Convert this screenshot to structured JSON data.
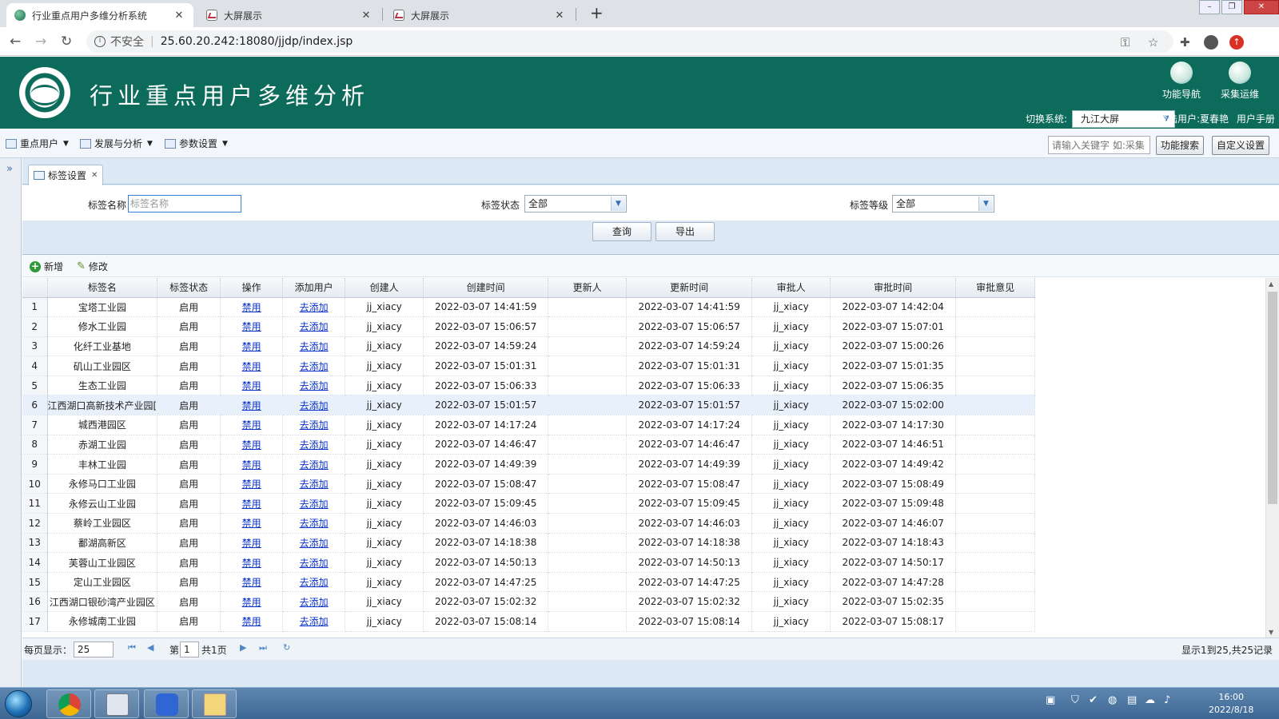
{
  "browser": {
    "tabs": [
      {
        "title": "行业重点用户多维分析系统",
        "active": true
      },
      {
        "title": "大屏展示",
        "active": false
      },
      {
        "title": "大屏展示",
        "active": false
      }
    ],
    "insecure_label": "不安全",
    "url": "25.60.20.242:18080/jjdp/index.jsp"
  },
  "header": {
    "title": "行业重点用户多维分析",
    "nav_button": "功能导航",
    "collect_button": "采集运维",
    "switch_label": "切换系统:",
    "switch_value": "九江大屏",
    "user_label": "登陆用户:夏春艳",
    "manual": "用户手册"
  },
  "menubar": {
    "items": [
      "重点用户",
      "发展与分析",
      "参数设置"
    ],
    "search_placeholder": "请输入关键字 如:采集",
    "search_button": "功能搜索",
    "custom_button": "自定义设置"
  },
  "panel": {
    "tab_label": "标签设置",
    "filters": {
      "name_label": "标签名称",
      "name_placeholder": "标签名称",
      "status_label": "标签状态",
      "status_value": "全部",
      "level_label": "标签等级",
      "level_value": "全部"
    },
    "query_button": "查询",
    "export_button": "导出",
    "add_button": "新增",
    "edit_button": "修改"
  },
  "grid": {
    "columns": [
      "标签名",
      "标签状态",
      "操作",
      "添加用户",
      "创建人",
      "创建时间",
      "更新人",
      "更新时间",
      "审批人",
      "审批时间",
      "审批意见"
    ],
    "selected_row": 6,
    "rows": [
      {
        "n": "1",
        "name": "宝塔工业园",
        "status": "启用",
        "op": "禁用",
        "add": "去添加",
        "creator": "jj_xiacy",
        "ctime": "2022-03-07 14:41:59",
        "updater": "",
        "utime": "2022-03-07 14:41:59",
        "approver": "jj_xiacy",
        "atime": "2022-03-07 14:42:04",
        "opinion": ""
      },
      {
        "n": "2",
        "name": "修水工业园",
        "status": "启用",
        "op": "禁用",
        "add": "去添加",
        "creator": "jj_xiacy",
        "ctime": "2022-03-07 15:06:57",
        "updater": "",
        "utime": "2022-03-07 15:06:57",
        "approver": "jj_xiacy",
        "atime": "2022-03-07 15:07:01",
        "opinion": ""
      },
      {
        "n": "3",
        "name": "化纤工业基地",
        "status": "启用",
        "op": "禁用",
        "add": "去添加",
        "creator": "jj_xiacy",
        "ctime": "2022-03-07 14:59:24",
        "updater": "",
        "utime": "2022-03-07 14:59:24",
        "approver": "jj_xiacy",
        "atime": "2022-03-07 15:00:26",
        "opinion": ""
      },
      {
        "n": "4",
        "name": "矶山工业园区",
        "status": "启用",
        "op": "禁用",
        "add": "去添加",
        "creator": "jj_xiacy",
        "ctime": "2022-03-07 15:01:31",
        "updater": "",
        "utime": "2022-03-07 15:01:31",
        "approver": "jj_xiacy",
        "atime": "2022-03-07 15:01:35",
        "opinion": ""
      },
      {
        "n": "5",
        "name": "生态工业园",
        "status": "启用",
        "op": "禁用",
        "add": "去添加",
        "creator": "jj_xiacy",
        "ctime": "2022-03-07 15:06:33",
        "updater": "",
        "utime": "2022-03-07 15:06:33",
        "approver": "jj_xiacy",
        "atime": "2022-03-07 15:06:35",
        "opinion": ""
      },
      {
        "n": "6",
        "name": "江西湖口高新技术产业园[",
        "status": "启用",
        "op": "禁用",
        "add": "去添加",
        "creator": "jj_xiacy",
        "ctime": "2022-03-07 15:01:57",
        "updater": "",
        "utime": "2022-03-07 15:01:57",
        "approver": "jj_xiacy",
        "atime": "2022-03-07 15:02:00",
        "opinion": ""
      },
      {
        "n": "7",
        "name": "城西港园区",
        "status": "启用",
        "op": "禁用",
        "add": "去添加",
        "creator": "jj_xiacy",
        "ctime": "2022-03-07 14:17:24",
        "updater": "",
        "utime": "2022-03-07 14:17:24",
        "approver": "jj_xiacy",
        "atime": "2022-03-07 14:17:30",
        "opinion": ""
      },
      {
        "n": "8",
        "name": "赤湖工业园",
        "status": "启用",
        "op": "禁用",
        "add": "去添加",
        "creator": "jj_xiacy",
        "ctime": "2022-03-07 14:46:47",
        "updater": "",
        "utime": "2022-03-07 14:46:47",
        "approver": "jj_xiacy",
        "atime": "2022-03-07 14:46:51",
        "opinion": ""
      },
      {
        "n": "9",
        "name": "丰林工业园",
        "status": "启用",
        "op": "禁用",
        "add": "去添加",
        "creator": "jj_xiacy",
        "ctime": "2022-03-07 14:49:39",
        "updater": "",
        "utime": "2022-03-07 14:49:39",
        "approver": "jj_xiacy",
        "atime": "2022-03-07 14:49:42",
        "opinion": ""
      },
      {
        "n": "10",
        "name": "永修马口工业园",
        "status": "启用",
        "op": "禁用",
        "add": "去添加",
        "creator": "jj_xiacy",
        "ctime": "2022-03-07 15:08:47",
        "updater": "",
        "utime": "2022-03-07 15:08:47",
        "approver": "jj_xiacy",
        "atime": "2022-03-07 15:08:49",
        "opinion": ""
      },
      {
        "n": "11",
        "name": "永修云山工业园",
        "status": "启用",
        "op": "禁用",
        "add": "去添加",
        "creator": "jj_xiacy",
        "ctime": "2022-03-07 15:09:45",
        "updater": "",
        "utime": "2022-03-07 15:09:45",
        "approver": "jj_xiacy",
        "atime": "2022-03-07 15:09:48",
        "opinion": ""
      },
      {
        "n": "12",
        "name": "蔡岭工业园区",
        "status": "启用",
        "op": "禁用",
        "add": "去添加",
        "creator": "jj_xiacy",
        "ctime": "2022-03-07 14:46:03",
        "updater": "",
        "utime": "2022-03-07 14:46:03",
        "approver": "jj_xiacy",
        "atime": "2022-03-07 14:46:07",
        "opinion": ""
      },
      {
        "n": "13",
        "name": "鄱湖高新区",
        "status": "启用",
        "op": "禁用",
        "add": "去添加",
        "creator": "jj_xiacy",
        "ctime": "2022-03-07 14:18:38",
        "updater": "",
        "utime": "2022-03-07 14:18:38",
        "approver": "jj_xiacy",
        "atime": "2022-03-07 14:18:43",
        "opinion": ""
      },
      {
        "n": "14",
        "name": "芙蓉山工业园区",
        "status": "启用",
        "op": "禁用",
        "add": "去添加",
        "creator": "jj_xiacy",
        "ctime": "2022-03-07 14:50:13",
        "updater": "",
        "utime": "2022-03-07 14:50:13",
        "approver": "jj_xiacy",
        "atime": "2022-03-07 14:50:17",
        "opinion": ""
      },
      {
        "n": "15",
        "name": "定山工业园区",
        "status": "启用",
        "op": "禁用",
        "add": "去添加",
        "creator": "jj_xiacy",
        "ctime": "2022-03-07 14:47:25",
        "updater": "",
        "utime": "2022-03-07 14:47:25",
        "approver": "jj_xiacy",
        "atime": "2022-03-07 14:47:28",
        "opinion": ""
      },
      {
        "n": "16",
        "name": "江西湖口银砂湾产业园区",
        "status": "启用",
        "op": "禁用",
        "add": "去添加",
        "creator": "jj_xiacy",
        "ctime": "2022-03-07 15:02:32",
        "updater": "",
        "utime": "2022-03-07 15:02:32",
        "approver": "jj_xiacy",
        "atime": "2022-03-07 15:02:35",
        "opinion": ""
      },
      {
        "n": "17",
        "name": "永修城南工业园",
        "status": "启用",
        "op": "禁用",
        "add": "去添加",
        "creator": "jj_xiacy",
        "ctime": "2022-03-07 15:08:14",
        "updater": "",
        "utime": "2022-03-07 15:08:14",
        "approver": "jj_xiacy",
        "atime": "2022-03-07 15:08:17",
        "opinion": ""
      }
    ]
  },
  "pager": {
    "page_size_label": "每页显示：",
    "page_size": "25",
    "page_prefix": "第",
    "page_value": "1",
    "page_total": "共1页",
    "summary": "显示1到25,共25记录"
  },
  "taskbar": {
    "time": "16:00",
    "date": "2022/8/18"
  },
  "colors": {
    "header_green": "#0c6b5b",
    "link_blue": "#0a32c8",
    "selected_row": "#e8f1fb"
  }
}
